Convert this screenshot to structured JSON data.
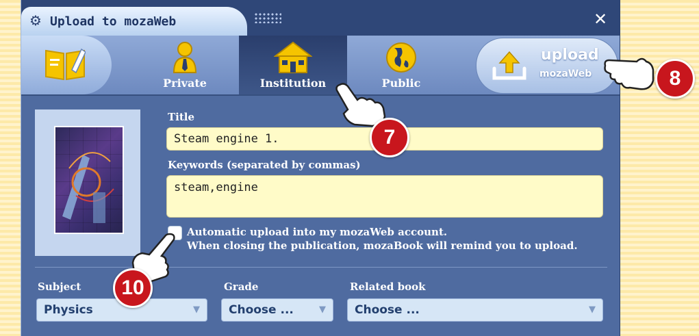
{
  "window": {
    "title": "Upload to mozaWeb"
  },
  "toolbar": {
    "tabs": [
      {
        "label": "Private",
        "icon": "person-icon"
      },
      {
        "label": "Institution",
        "icon": "house-icon",
        "active": true
      },
      {
        "label": "Public",
        "icon": "globe-icon"
      }
    ],
    "upload": {
      "main": "upload",
      "sub": "mozaWeb"
    }
  },
  "form": {
    "title_label": "Title",
    "title_value": "Steam engine 1.",
    "keywords_label": "Keywords (separated by commas)",
    "keywords_value": "steam,engine",
    "auto_line1": "Automatic upload into my mozaWeb account.",
    "auto_line2": "When closing the publication, mozaBook will remind you to upload.",
    "subject_label": "Subject",
    "subject_value": "Physics",
    "grade_label": "Grade",
    "grade_value": "Choose ...",
    "related_label": "Related book",
    "related_value": "Choose ..."
  },
  "callouts": {
    "seven": "7",
    "eight": "8",
    "ten": "10"
  },
  "colors": {
    "accent_red": "#c8161d",
    "field_yellow": "#fffbc8",
    "panel_blue": "#4f6ba0"
  }
}
